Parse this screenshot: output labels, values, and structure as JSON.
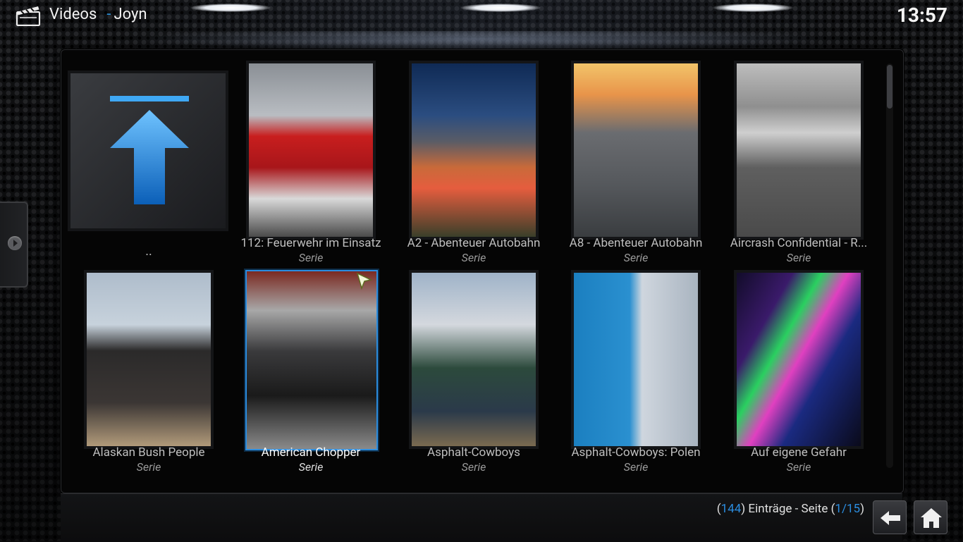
{
  "header": {
    "section": "Videos",
    "separator": "-",
    "addon": "Joyn",
    "clock": "13:57"
  },
  "grid": {
    "parent": {
      "label": ".."
    },
    "items": [
      {
        "title": "112: Feuerwehr im Einsatz",
        "type": "Serie",
        "image": "fire-trucks"
      },
      {
        "title": "A2 - Abenteuer Autobahn",
        "type": "Serie",
        "image": "highway-night"
      },
      {
        "title": "A8 - Abenteuer Autobahn",
        "type": "Serie",
        "image": "highway-sunset"
      },
      {
        "title": "Aircrash Confidential - R...",
        "type": "Serie",
        "image": "plane-wreck"
      },
      {
        "title": "Alaskan Bush People",
        "type": "Serie",
        "image": "family-group"
      },
      {
        "title": "American Chopper",
        "type": "Serie",
        "image": "motorcycle",
        "focused": true
      },
      {
        "title": "Asphalt-Cowboys",
        "type": "Serie",
        "image": "trucker"
      },
      {
        "title": "Asphalt-Cowboys: Polen",
        "type": "Serie",
        "image": "two-women"
      },
      {
        "title": "Auf eigene Gefahr",
        "type": "Serie",
        "image": "neon-lights"
      }
    ]
  },
  "footer": {
    "open_paren": "(",
    "count": "144",
    "entries_text": ") Einträge - Seite (",
    "page": "1/15",
    "close_paren": ")"
  },
  "colors": {
    "accent": "#2b8de0",
    "background": "#111214"
  }
}
